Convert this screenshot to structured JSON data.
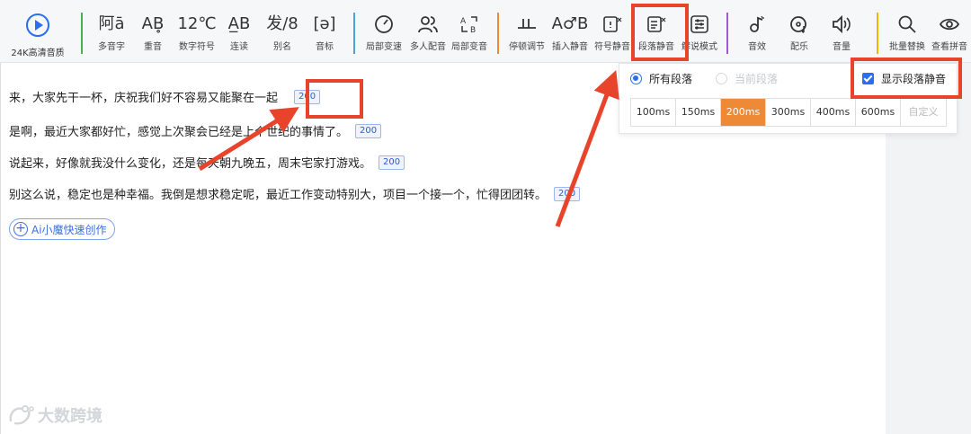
{
  "toolbar": {
    "play_label": "24K高清音质",
    "tools": [
      {
        "glyph": "阿ā",
        "label": "多音字"
      },
      {
        "glyph": "AB̥",
        "label": "重音"
      },
      {
        "glyph": "12℃",
        "label": "数字符号"
      },
      {
        "glyph": "A̲B",
        "label": "连读"
      },
      {
        "glyph": "发/8",
        "label": "别名"
      },
      {
        "glyph": "[ə]",
        "label": "音标"
      },
      {
        "glyph": "",
        "label": "局部变速"
      },
      {
        "glyph": "",
        "label": "多人配音"
      },
      {
        "glyph": "",
        "label": "局部变音"
      },
      {
        "glyph": "",
        "label": "停顿调节"
      },
      {
        "glyph": "A♂B",
        "label": "插入静音"
      },
      {
        "glyph": "",
        "label": "符号静音"
      },
      {
        "glyph": "",
        "label": "段落静音"
      },
      {
        "glyph": "",
        "label": "解说模式"
      },
      {
        "glyph": "",
        "label": "音效"
      },
      {
        "glyph": "",
        "label": "配乐"
      },
      {
        "glyph": "",
        "label": "音量"
      },
      {
        "glyph": "",
        "label": "批量替换"
      },
      {
        "glyph": "",
        "label": "查看拼音"
      }
    ]
  },
  "paragraphs": [
    {
      "text": "来，大家先干一杯，庆祝我们好不容易又能聚在一起",
      "pause": "200"
    },
    {
      "text": "是啊，最近大家都好忙，感觉上次聚会已经是上个世纪的事情了。",
      "pause": "200"
    },
    {
      "text": "说起来，好像就我没什么变化，还是每天朝九晚五，周末宅家打游戏。",
      "pause": "200"
    },
    {
      "text": "别这么说，稳定也是种幸福。我倒是想求稳定呢，最近工作变动特别大，项目一个接一个，忙得团团转。",
      "pause": "200"
    }
  ],
  "ai_button": "Ai小魔快速创作",
  "popup": {
    "scope_all": "所有段落",
    "scope_current": "当前段落",
    "show_silence": "显示段落静音",
    "durations": [
      "100ms",
      "150ms",
      "200ms",
      "300ms",
      "400ms",
      "600ms",
      "自定义"
    ],
    "selected": "200ms"
  },
  "watermark": "大数跨境",
  "colors": {
    "accent": "#2b6ef0",
    "selected": "#ee8a35",
    "annotation": "#e8442c"
  }
}
